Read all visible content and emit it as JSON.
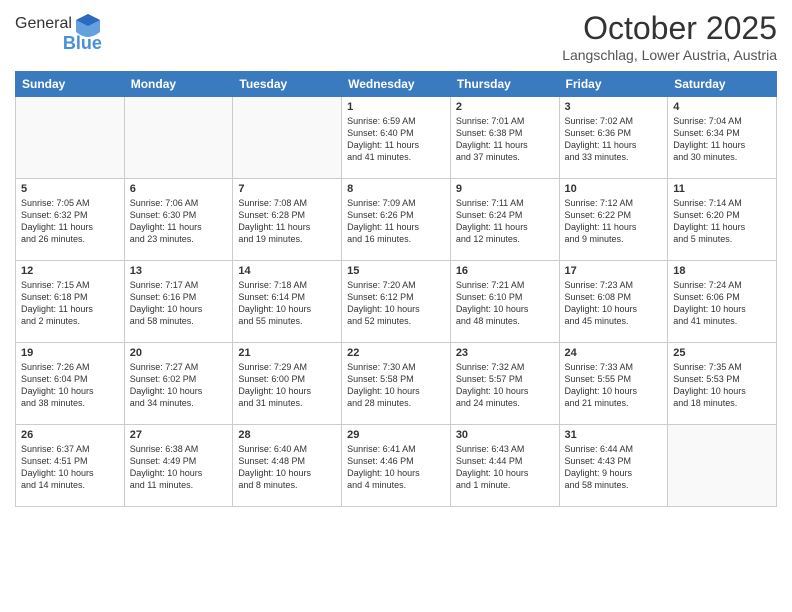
{
  "header": {
    "logo_general": "General",
    "logo_blue": "Blue",
    "month_title": "October 2025",
    "location": "Langschlag, Lower Austria, Austria"
  },
  "weekdays": [
    "Sunday",
    "Monday",
    "Tuesday",
    "Wednesday",
    "Thursday",
    "Friday",
    "Saturday"
  ],
  "weeks": [
    [
      {
        "day": "",
        "info": ""
      },
      {
        "day": "",
        "info": ""
      },
      {
        "day": "",
        "info": ""
      },
      {
        "day": "1",
        "info": "Sunrise: 6:59 AM\nSunset: 6:40 PM\nDaylight: 11 hours\nand 41 minutes."
      },
      {
        "day": "2",
        "info": "Sunrise: 7:01 AM\nSunset: 6:38 PM\nDaylight: 11 hours\nand 37 minutes."
      },
      {
        "day": "3",
        "info": "Sunrise: 7:02 AM\nSunset: 6:36 PM\nDaylight: 11 hours\nand 33 minutes."
      },
      {
        "day": "4",
        "info": "Sunrise: 7:04 AM\nSunset: 6:34 PM\nDaylight: 11 hours\nand 30 minutes."
      }
    ],
    [
      {
        "day": "5",
        "info": "Sunrise: 7:05 AM\nSunset: 6:32 PM\nDaylight: 11 hours\nand 26 minutes."
      },
      {
        "day": "6",
        "info": "Sunrise: 7:06 AM\nSunset: 6:30 PM\nDaylight: 11 hours\nand 23 minutes."
      },
      {
        "day": "7",
        "info": "Sunrise: 7:08 AM\nSunset: 6:28 PM\nDaylight: 11 hours\nand 19 minutes."
      },
      {
        "day": "8",
        "info": "Sunrise: 7:09 AM\nSunset: 6:26 PM\nDaylight: 11 hours\nand 16 minutes."
      },
      {
        "day": "9",
        "info": "Sunrise: 7:11 AM\nSunset: 6:24 PM\nDaylight: 11 hours\nand 12 minutes."
      },
      {
        "day": "10",
        "info": "Sunrise: 7:12 AM\nSunset: 6:22 PM\nDaylight: 11 hours\nand 9 minutes."
      },
      {
        "day": "11",
        "info": "Sunrise: 7:14 AM\nSunset: 6:20 PM\nDaylight: 11 hours\nand 5 minutes."
      }
    ],
    [
      {
        "day": "12",
        "info": "Sunrise: 7:15 AM\nSunset: 6:18 PM\nDaylight: 11 hours\nand 2 minutes."
      },
      {
        "day": "13",
        "info": "Sunrise: 7:17 AM\nSunset: 6:16 PM\nDaylight: 10 hours\nand 58 minutes."
      },
      {
        "day": "14",
        "info": "Sunrise: 7:18 AM\nSunset: 6:14 PM\nDaylight: 10 hours\nand 55 minutes."
      },
      {
        "day": "15",
        "info": "Sunrise: 7:20 AM\nSunset: 6:12 PM\nDaylight: 10 hours\nand 52 minutes."
      },
      {
        "day": "16",
        "info": "Sunrise: 7:21 AM\nSunset: 6:10 PM\nDaylight: 10 hours\nand 48 minutes."
      },
      {
        "day": "17",
        "info": "Sunrise: 7:23 AM\nSunset: 6:08 PM\nDaylight: 10 hours\nand 45 minutes."
      },
      {
        "day": "18",
        "info": "Sunrise: 7:24 AM\nSunset: 6:06 PM\nDaylight: 10 hours\nand 41 minutes."
      }
    ],
    [
      {
        "day": "19",
        "info": "Sunrise: 7:26 AM\nSunset: 6:04 PM\nDaylight: 10 hours\nand 38 minutes."
      },
      {
        "day": "20",
        "info": "Sunrise: 7:27 AM\nSunset: 6:02 PM\nDaylight: 10 hours\nand 34 minutes."
      },
      {
        "day": "21",
        "info": "Sunrise: 7:29 AM\nSunset: 6:00 PM\nDaylight: 10 hours\nand 31 minutes."
      },
      {
        "day": "22",
        "info": "Sunrise: 7:30 AM\nSunset: 5:58 PM\nDaylight: 10 hours\nand 28 minutes."
      },
      {
        "day": "23",
        "info": "Sunrise: 7:32 AM\nSunset: 5:57 PM\nDaylight: 10 hours\nand 24 minutes."
      },
      {
        "day": "24",
        "info": "Sunrise: 7:33 AM\nSunset: 5:55 PM\nDaylight: 10 hours\nand 21 minutes."
      },
      {
        "day": "25",
        "info": "Sunrise: 7:35 AM\nSunset: 5:53 PM\nDaylight: 10 hours\nand 18 minutes."
      }
    ],
    [
      {
        "day": "26",
        "info": "Sunrise: 6:37 AM\nSunset: 4:51 PM\nDaylight: 10 hours\nand 14 minutes."
      },
      {
        "day": "27",
        "info": "Sunrise: 6:38 AM\nSunset: 4:49 PM\nDaylight: 10 hours\nand 11 minutes."
      },
      {
        "day": "28",
        "info": "Sunrise: 6:40 AM\nSunset: 4:48 PM\nDaylight: 10 hours\nand 8 minutes."
      },
      {
        "day": "29",
        "info": "Sunrise: 6:41 AM\nSunset: 4:46 PM\nDaylight: 10 hours\nand 4 minutes."
      },
      {
        "day": "30",
        "info": "Sunrise: 6:43 AM\nSunset: 4:44 PM\nDaylight: 10 hours\nand 1 minute."
      },
      {
        "day": "31",
        "info": "Sunrise: 6:44 AM\nSunset: 4:43 PM\nDaylight: 9 hours\nand 58 minutes."
      },
      {
        "day": "",
        "info": ""
      }
    ]
  ]
}
